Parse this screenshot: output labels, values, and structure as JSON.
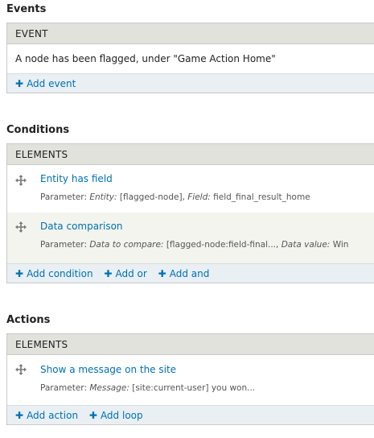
{
  "events": {
    "title": "Events",
    "header": "EVENT",
    "row": "A node has been flagged, under \"Game Action Home\"",
    "add_event": "Add event"
  },
  "conditions": {
    "title": "Conditions",
    "header": "ELEMENTS",
    "items": [
      {
        "title": "Entity has field",
        "param_label": "Parameter:",
        "k1": "Entity:",
        "v1": "[flagged-node],",
        "k2": "Field:",
        "v2": "field_final_result_home"
      },
      {
        "title": "Data comparison",
        "param_label": "Parameter:",
        "k1": "Data to compare:",
        "v1": "[flagged-node:field-final...,",
        "k2": "Data value:",
        "v2": "Win"
      }
    ],
    "add_condition": "Add condition",
    "add_or": "Add or",
    "add_and": "Add and"
  },
  "actions": {
    "title": "Actions",
    "header": "ELEMENTS",
    "items": [
      {
        "title": "Show a message on the site",
        "param_label": "Parameter:",
        "k1": "Message:",
        "v1": "[site:current-user] you won..."
      }
    ],
    "add_action": "Add action",
    "add_loop": "Add loop"
  },
  "icons": {
    "drag": "move-arrows-icon",
    "add": "plus-icon"
  },
  "colors": {
    "link": "#0071b3",
    "header_bg": "#e1e2dc",
    "action_bar_bg": "#e9eff3",
    "alt_row_bg": "#f3f4ee"
  }
}
